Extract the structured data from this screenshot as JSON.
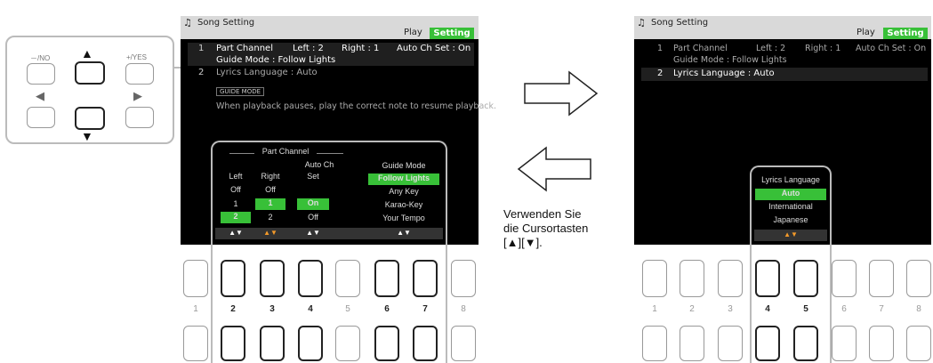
{
  "left_screen": {
    "title": "Song Setting",
    "tabs": {
      "play": "Play",
      "setting": "Setting"
    },
    "rows": [
      {
        "num": "1",
        "part_channel": "Part Channel",
        "left": "Left : 2",
        "right": "Right : 1",
        "auto": "Auto Ch Set : On"
      },
      {
        "guide": "Guide Mode : Follow Lights"
      },
      {
        "num": "2",
        "lyrics": "Lyrics Language : Auto"
      }
    ],
    "guide_tag": "GUIDE MODE",
    "guide_text": "When playback pauses, play the correct note to resume playback.",
    "panel": {
      "part_channel_header": "Part Channel",
      "auto_ch_header": "Auto Ch",
      "set_header": "Set",
      "left_header": "Left",
      "right_header": "Right",
      "left_vals": [
        "Off",
        "1",
        "2"
      ],
      "right_vals": [
        "Off",
        "1",
        "2"
      ],
      "auto_vals": [
        "On",
        "Off"
      ],
      "guide_header": "Guide Mode",
      "guide_vals": [
        "Follow Lights",
        "Any Key",
        "Karao-Key",
        "Your Tempo"
      ],
      "arrows": "▲▼"
    }
  },
  "right_screen": {
    "title": "Song Setting",
    "tabs": {
      "play": "Play",
      "setting": "Setting"
    },
    "rows": [
      {
        "num": "1",
        "part_channel": "Part Channel",
        "left": "Left : 2",
        "right": "Right : 1",
        "auto": "Auto Ch Set : On"
      },
      {
        "guide": "Guide Mode : Follow Lights"
      },
      {
        "num": "2",
        "lyrics": "Lyrics Language : Auto"
      }
    ],
    "panel": {
      "header": "Lyrics Language",
      "vals": [
        "Auto",
        "International",
        "Japanese"
      ],
      "arrows": "▲▼"
    }
  },
  "cursor_pad": {
    "no_label": "－/NO",
    "yes_label": "+/YES"
  },
  "instruction": [
    "Verwenden Sie",
    "die Cursortasten",
    "[▲][▼]."
  ],
  "button_numbers": [
    "1",
    "2",
    "3",
    "4",
    "5",
    "6",
    "7",
    "8"
  ]
}
